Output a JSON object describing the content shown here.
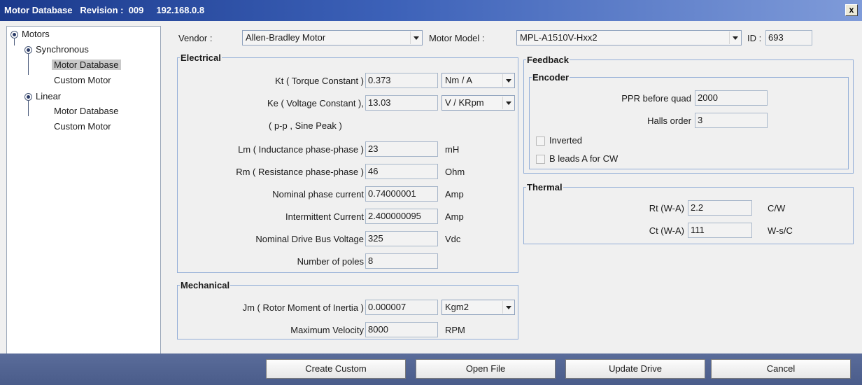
{
  "window": {
    "title": "Motor Database   Revision :  009     192.168.0.8",
    "close_label": "x"
  },
  "tree": {
    "root": "Motors",
    "synchronous": "Synchronous",
    "sync_motor_db": "Motor Database",
    "sync_custom": "Custom Motor",
    "linear": "Linear",
    "lin_motor_db": "Motor Database",
    "lin_custom": "Custom Motor"
  },
  "header": {
    "vendor_label": "Vendor :",
    "vendor_value": "Allen-Bradley Motor",
    "model_label": "Motor Model :",
    "model_value": "MPL-A1510V-Hxx2",
    "id_label": "ID :",
    "id_value": "693"
  },
  "electrical": {
    "title": "Electrical",
    "kt_label": "Kt ( Torque Constant )",
    "kt_value": "0.373",
    "kt_unit": "Nm / A",
    "ke_label": "Ke ( Voltage Constant ),",
    "ke_value": "13.03",
    "ke_unit": "V / KRpm",
    "ke_note": "( p-p , Sine Peak )",
    "lm_label": "Lm ( Inductance phase-phase )",
    "lm_value": "23",
    "lm_unit": "mH",
    "rm_label": "Rm ( Resistance phase-phase )",
    "rm_value": "46",
    "rm_unit": "Ohm",
    "nom_current_label": "Nominal phase current",
    "nom_current_value": "0.74000001",
    "nom_current_unit": "Amp",
    "int_current_label": "Intermittent Current",
    "int_current_value": "2.400000095",
    "int_current_unit": "Amp",
    "bus_label": "Nominal Drive Bus Voltage",
    "bus_value": "325",
    "bus_unit": "Vdc",
    "poles_label": "Number of poles",
    "poles_value": "8"
  },
  "mechanical": {
    "title": "Mechanical",
    "jm_label": "Jm ( Rotor Moment of Inertia )",
    "jm_value": "0.000007",
    "jm_unit": "Kgm2",
    "vel_label": "Maximum Velocity",
    "vel_value": "8000",
    "vel_unit": "RPM"
  },
  "feedback": {
    "title": "Feedback",
    "encoder_title": "Encoder",
    "ppr_label": "PPR before quad",
    "ppr_value": "2000",
    "halls_label": "Halls order",
    "halls_value": "3",
    "inverted_label": "Inverted",
    "bleads_label": "B leads A for CW"
  },
  "thermal": {
    "title": "Thermal",
    "rt_label": "Rt (W-A)",
    "rt_value": "2.2",
    "rt_unit": "C/W",
    "ct_label": "Ct (W-A)",
    "ct_value": "111",
    "ct_unit": "W-s/C"
  },
  "buttons": {
    "create_custom": "Create Custom",
    "open_file": "Open File",
    "update_drive": "Update Drive",
    "cancel": "Cancel"
  }
}
